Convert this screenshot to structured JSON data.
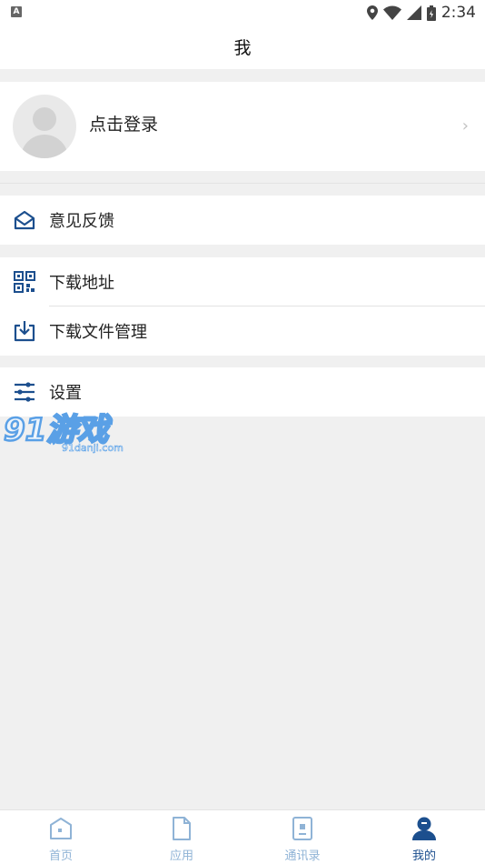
{
  "status_bar": {
    "time": "2:34"
  },
  "header": {
    "title": "我"
  },
  "profile": {
    "login_text": "点击登录"
  },
  "menu": [
    {
      "label": "意见反馈",
      "icon": "envelope-icon"
    },
    {
      "label": "下载地址",
      "icon": "qr-code-icon"
    },
    {
      "label": "下载文件管理",
      "icon": "download-box-icon"
    },
    {
      "label": "设置",
      "icon": "sliders-icon"
    }
  ],
  "watermark": {
    "big": "91游戏",
    "small": "91danji.com"
  },
  "tabs": [
    {
      "label": "首页",
      "icon": "home-icon",
      "active": false
    },
    {
      "label": "应用",
      "icon": "document-icon",
      "active": false
    },
    {
      "label": "通讯录",
      "icon": "contacts-icon",
      "active": false
    },
    {
      "label": "我的",
      "icon": "person-icon",
      "active": true
    }
  ],
  "colors": {
    "primary": "#1c4f8e",
    "inactive": "#8fb3d6",
    "background": "#f0f0f0"
  }
}
